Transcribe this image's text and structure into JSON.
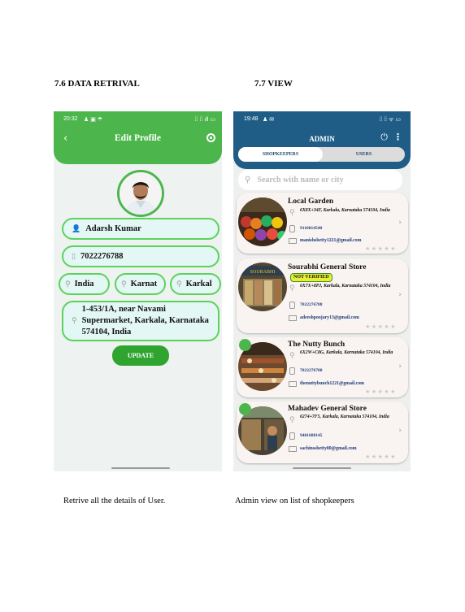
{
  "left": {
    "heading": "7.6 DATA RETRIVAL",
    "caption": "Retrive all the details of User.",
    "status_time": "20:32",
    "status_icons_left": "♟ ▣ ☂",
    "status_icons_right": "⁞⁞ ⁞⁞ ıll ▭",
    "title": "Edit Profile",
    "name": "Adarsh Kumar",
    "phone": "7022276788",
    "country": "India",
    "state": "Karnat",
    "city": "Karkal",
    "address": "1-453/1A, near Navami Supermarket, Karkala, Karnataka 574104, India",
    "update_label": "UPDATE"
  },
  "right": {
    "heading": "7.7 VIEW",
    "caption": "Admin view on list of shopkeepers",
    "status_time": "19:48",
    "status_icons_left": "♟ ✉",
    "status_icons_right": "⁞⁞ ⁞⁞ ᯤ ▭",
    "title": "ADMIN",
    "tab_shopkeepers": "SHOPKEEPERS",
    "tab_users": "USERS",
    "search_placeholder": "Search with name or city",
    "badge_not_verified": "NOT VERIFIED",
    "shops": [
      {
        "name": "Local Garden",
        "address": "6X8X+34F, Karkala, Karnataka 574104, India",
        "phone": "9110814540",
        "email": "manishshetty1221@gmail.com"
      },
      {
        "name": "Sourabhi General Store",
        "address": "6X7X+8PJ, Karkala, Karnataka 574104, India",
        "phone": "7022276788",
        "email": "adeeshpoojary13@gmail.com"
      },
      {
        "name": "The Nutty Bunch",
        "address": "6X2W+C8G, Karkala, Karnataka 574104, India",
        "phone": "7022276788",
        "email": "thenuttybunch1221@gmail.com"
      },
      {
        "name": "Mahadev General Store",
        "address": "6274+7F5, Karkala, Karnataka 574104, India",
        "phone": "9481688145",
        "email": "sachinsshetty80@gmail.com"
      }
    ]
  }
}
